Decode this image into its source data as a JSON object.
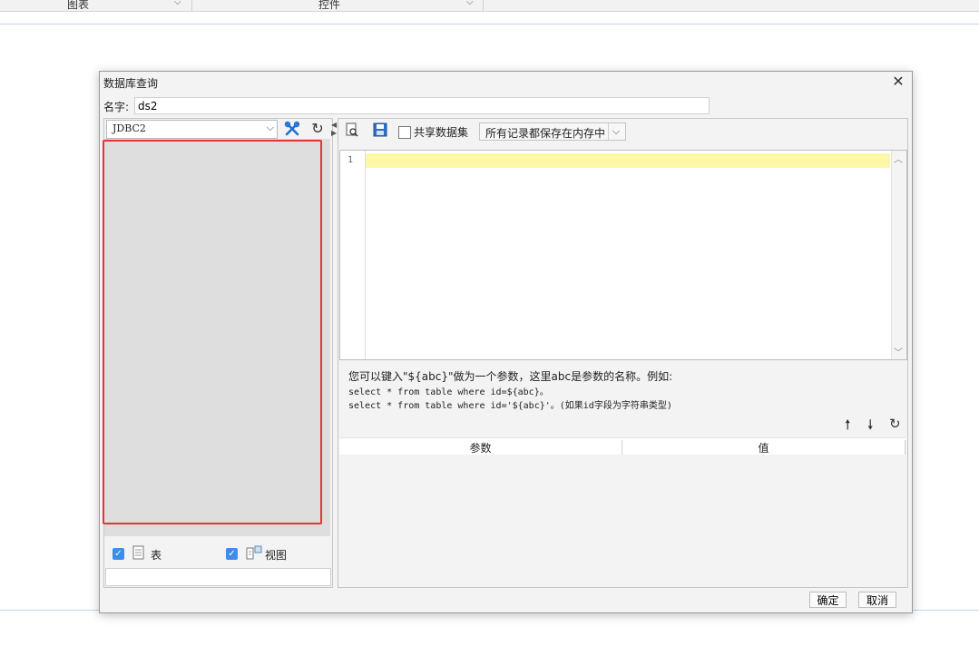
{
  "background": {
    "toolbar": {
      "item1": "图表",
      "item2": "控件"
    }
  },
  "dialog": {
    "title": "数据库查询",
    "close_glyph": "✕",
    "name_label": "名字:",
    "name_value": "ds2",
    "left": {
      "connection": "JDBC2",
      "tables_label": "表",
      "views_label": "视图"
    },
    "right": {
      "share_label": "共享数据集",
      "memory_option": "所有记录都保存在内存中",
      "editor_line": "1",
      "hint_line1": "您可以键入\"${abc}\"做为一个参数，这里abc是参数的名称。例如:",
      "hint_line2": "select * from table where id=${abc}。",
      "hint_line3": "select * from table where id='${abc}'。(如果id字段为字符串类型)",
      "param_col1": "参数",
      "param_col2": "值"
    },
    "ok_label": "确定",
    "cancel_label": "取消"
  },
  "colors": {
    "highlight": "#fdf8a8",
    "selection_box": "#e83333",
    "checkbox": "#3d8ee8"
  },
  "icons": [
    "chevron-down-icon",
    "close-icon",
    "wrench-icon",
    "refresh-icon",
    "preview-icon",
    "save-icon",
    "arrow-up-icon",
    "arrow-down-icon",
    "table-icon",
    "view-icon"
  ]
}
